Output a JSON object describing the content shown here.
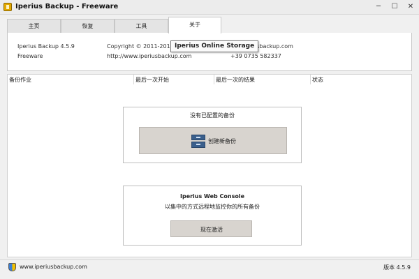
{
  "window": {
    "title": "Iperius Backup - Freeware",
    "minimize": "─",
    "maximize": "☐",
    "close": "✕"
  },
  "tabs": [
    {
      "label": "主页",
      "active": false
    },
    {
      "label": "恢复",
      "active": false
    },
    {
      "label": "工具",
      "active": false
    },
    {
      "label": "关于",
      "active": true
    }
  ],
  "about": {
    "product": "Iperius Backup  4.5.9",
    "edition": "Freeware",
    "copyright": "Copyright © 2011-2016 En",
    "website": "http://www.iperiusbackup.com",
    "email": "rt@iperiusbackup.com",
    "phone": "+39 0735 582337"
  },
  "tooltip": "Iperius Online Storage",
  "grid": {
    "columns": [
      "备份作业",
      "最后一次开始",
      "最后一次的结果",
      "状态"
    ]
  },
  "empty_card": {
    "message": "没有已配置的备份",
    "create_button": "创建新备份",
    "create_icon": "database-icon"
  },
  "console_card": {
    "title": "Iperius Web Console",
    "subtitle": "以集中的方式远程地监控你的所有备份",
    "activate_button": "现在激活"
  },
  "status": {
    "link": "www.iperiusbackup.com",
    "version": "版本 4.5.9",
    "icon": "shield-icon"
  }
}
